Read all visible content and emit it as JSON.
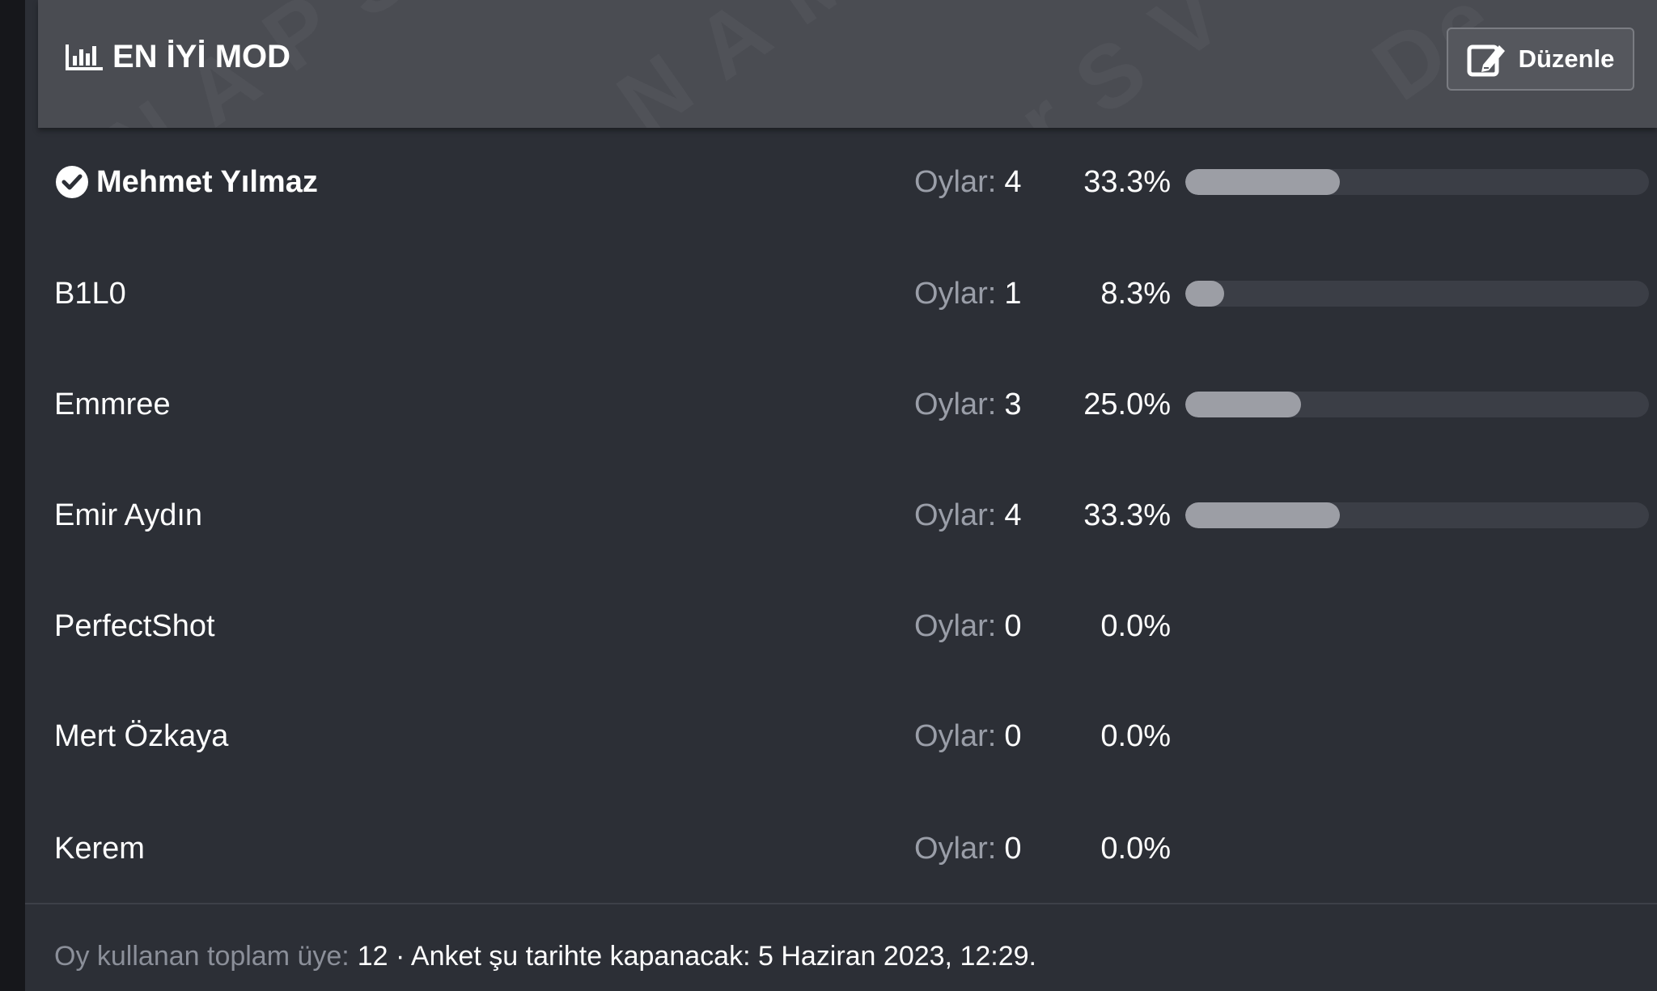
{
  "poll": {
    "title": "EN İYİ MOD",
    "title_icon": "bar-chart-icon",
    "edit_label": "Düzenle",
    "edit_icon": "edit-icon",
    "options": [
      {
        "name": "Mehmet Yılmaz",
        "votes_label": "Oylar:",
        "votes": "4",
        "percent": "33.3%",
        "fraction": 0.333,
        "chosen": true
      },
      {
        "name": "B1L0",
        "votes_label": "Oylar:",
        "votes": "1",
        "percent": "8.3%",
        "fraction": 0.083,
        "chosen": false
      },
      {
        "name": "Emmree",
        "votes_label": "Oylar:",
        "votes": "3",
        "percent": "25.0%",
        "fraction": 0.25,
        "chosen": false
      },
      {
        "name": "Emir Aydın",
        "votes_label": "Oylar:",
        "votes": "4",
        "percent": "33.3%",
        "fraction": 0.333,
        "chosen": false
      },
      {
        "name": "PerfectShot",
        "votes_label": "Oylar:",
        "votes": "0",
        "percent": "0.0%",
        "fraction": 0,
        "chosen": false
      },
      {
        "name": "Mert Özkaya",
        "votes_label": "Oylar:",
        "votes": "0",
        "percent": "0.0%",
        "fraction": 0,
        "chosen": false
      },
      {
        "name": "Kerem",
        "votes_label": "Oylar:",
        "votes": "0",
        "percent": "0.0%",
        "fraction": 0,
        "chosen": false
      }
    ],
    "footer": {
      "total_label": "Oy kullanan toplam üye:",
      "total_and_close": "12 · Anket şu tarihte kapanacak: 5 Haziran 2023, 12:29."
    }
  },
  "colors": {
    "panel_bg": "#2c2f36",
    "header_bg": "#4a4c52",
    "bar_fill": "#9c9ea5",
    "bar_track": "#3b3e46",
    "muted_text": "#9a9ea8"
  }
}
